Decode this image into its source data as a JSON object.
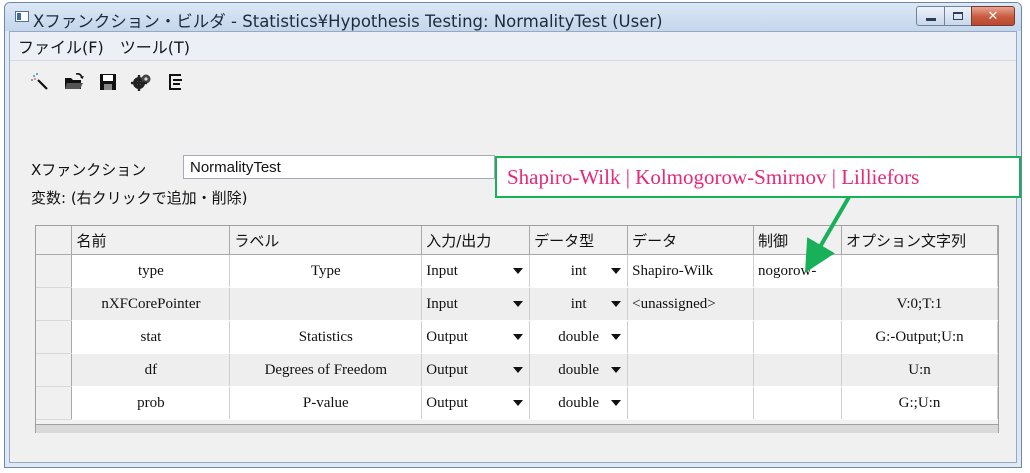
{
  "window": {
    "title": "Xファンクション・ビルダ - Statistics¥Hypothesis Testing: NormalityTest (User)",
    "buttons": {
      "minimize": "minimize",
      "maximize": "maximize",
      "close": "✕"
    }
  },
  "menu": {
    "items": [
      "ファイル(F)",
      "ツール(T)"
    ]
  },
  "toolbar": {
    "icons": [
      "wand-icon",
      "open-folder-icon",
      "save-icon",
      "compile-gear-icon",
      "tree-view-icon"
    ]
  },
  "form": {
    "xfunction_label": "Xファンクション",
    "xfunction_value": "NormalityTest",
    "variables_label": "変数: (右クリックで追加・削除)"
  },
  "table": {
    "headers": [
      "名前",
      "ラベル",
      "入力/出力",
      "データ型",
      "データ",
      "制御",
      "オプション文字列"
    ],
    "rows": [
      {
        "name": "type",
        "label": "Type",
        "io": "Input",
        "dtype": "int",
        "data": "Shapiro-Wilk",
        "control": "nogorow-",
        "option": ""
      },
      {
        "name": "nXFCorePointer",
        "label": "",
        "io": "Input",
        "dtype": "int",
        "data": "<unassigned>",
        "control": "",
        "option": "V:0;T:1"
      },
      {
        "name": "stat",
        "label": "Statistics",
        "io": "Output",
        "dtype": "double",
        "data": "",
        "control": "",
        "option": "G:-Output;U:n"
      },
      {
        "name": "df",
        "label": "Degrees of Freedom",
        "io": "Output",
        "dtype": "double",
        "data": "",
        "control": "",
        "option": "U:n"
      },
      {
        "name": "prob",
        "label": "P-value",
        "io": "Output",
        "dtype": "double",
        "data": "",
        "control": "",
        "option": "G:;U:n"
      }
    ]
  },
  "callout": {
    "text": "Shapiro-Wilk | Kolmogorow-Smirnov | Lilliefors",
    "border_color": "#19b05a",
    "text_color": "#e4287b"
  }
}
